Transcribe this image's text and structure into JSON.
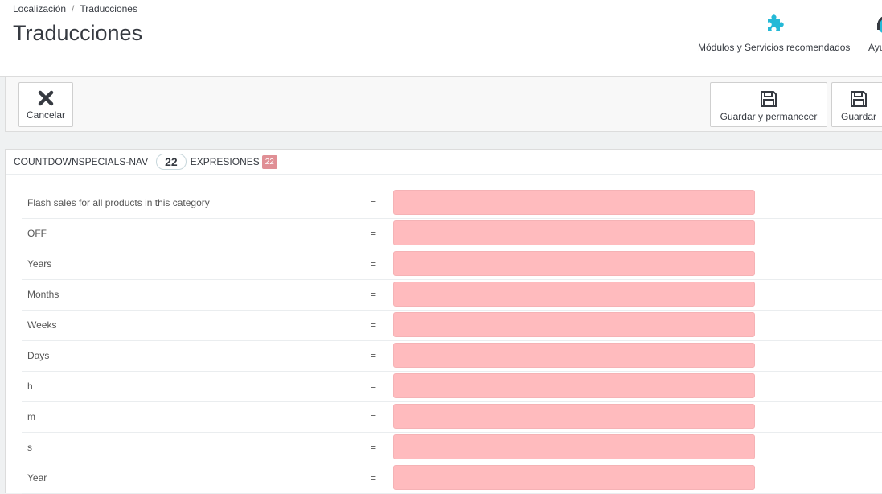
{
  "breadcrumb": {
    "parent": "Localización",
    "separator": "/",
    "current": "Traducciones"
  },
  "page_title": "Traducciones",
  "header_toolbar": {
    "modules_label": "Módulos y Servicios recomendados",
    "modules_icon": "puzzle-icon",
    "help_label": "Ayuda",
    "help_icon": "help-icon",
    "accent_color": "#25b9d7"
  },
  "toolbar": {
    "cancel_label": "Cancelar",
    "cancel_icon": "close-icon",
    "save_stay_label": "Guardar y permanecer",
    "save_label": "Guardar",
    "save_icon": "floppy-disk-icon"
  },
  "panel": {
    "module_name": "COUNTDOWNSPECIALS-NAV",
    "expression_count": "22",
    "expressions_label": "EXPRESIONES",
    "missing_count": "22",
    "missing_color": "#e08f95",
    "input_missing_color": "#ffbbbe"
  },
  "rows": [
    {
      "key": "Flash sales for all products in this category",
      "eq": "=",
      "value": ""
    },
    {
      "key": "OFF",
      "eq": "=",
      "value": ""
    },
    {
      "key": "Years",
      "eq": "=",
      "value": ""
    },
    {
      "key": "Months",
      "eq": "=",
      "value": ""
    },
    {
      "key": "Weeks",
      "eq": "=",
      "value": ""
    },
    {
      "key": "Days",
      "eq": "=",
      "value": ""
    },
    {
      "key": "h",
      "eq": "=",
      "value": ""
    },
    {
      "key": "m",
      "eq": "=",
      "value": ""
    },
    {
      "key": "s",
      "eq": "=",
      "value": ""
    },
    {
      "key": "Year",
      "eq": "=",
      "value": ""
    }
  ]
}
